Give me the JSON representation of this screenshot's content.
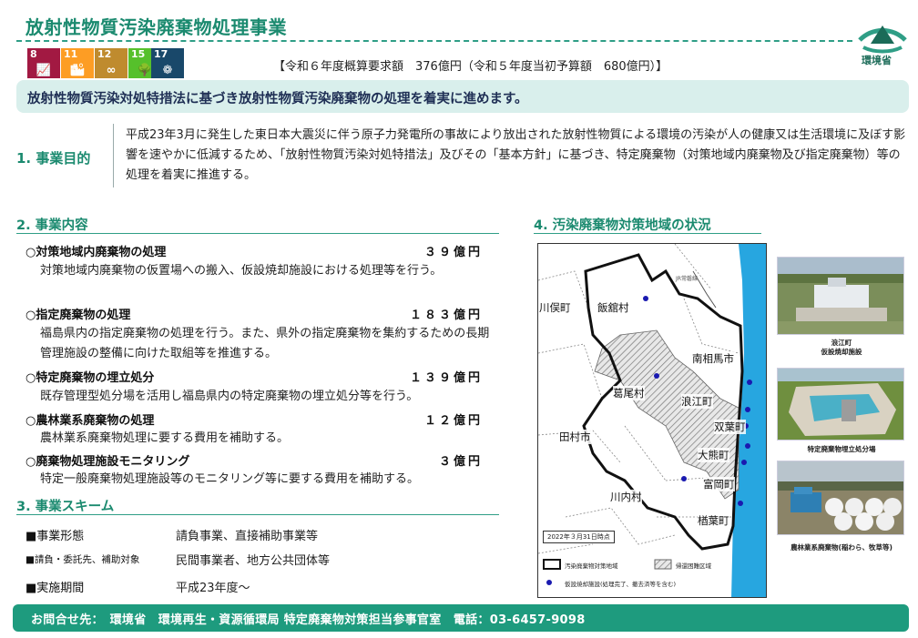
{
  "header": {
    "title": "放射性物質汚染廃棄物処理事業",
    "ministry": "環境省",
    "budget": "【令和６年度概算要求額　376億円（令和５年度当初予算額　680億円）】"
  },
  "sdgs": [
    {
      "number": "8",
      "label": "",
      "color": "#a21942",
      "glyph": "📈"
    },
    {
      "number": "11",
      "label": "",
      "color": "#fd9d24",
      "glyph": "🏙"
    },
    {
      "number": "12",
      "label": "",
      "color": "#bf8b2e",
      "glyph": "∞"
    },
    {
      "number": "15",
      "label": "",
      "color": "#56c02b",
      "glyph": "🌳"
    },
    {
      "number": "17",
      "label": "",
      "color": "#19486a",
      "glyph": "❁"
    }
  ],
  "banner": "放射性物質汚染対処特措法に基づき放射性物質汚染廃棄物の処理を着実に進めます。",
  "purpose": {
    "heading": "1. 事業目的",
    "text": "平成23年3月に発生した東日本大震災に伴う原子力発電所の事故により放出された放射性物質による環境の汚染が人の健康又は生活環境に及ぼす影響を速やかに低減するため、「放射性物質汚染対処特措法」及びその「基本方針」に基づき、特定廃棄物（対策地域内廃棄物及び指定廃棄物）等の処理を着実に推進する。"
  },
  "contents": {
    "heading": "2. 事業内容",
    "items": [
      {
        "title": "○対策地域内廃棄物の処理",
        "amount": "３９億円",
        "desc": "対策地域内廃棄物の仮置場への搬入、仮設焼却施設における処理等を行う。"
      },
      {
        "title": "○指定廃棄物の処理",
        "amount": "１８３億円",
        "desc": "福島県内の指定廃棄物の処理を行う。また、県外の指定廃棄物を集約するための長期管理施設の整備に向けた取組等を推進する。"
      },
      {
        "title": "○特定廃棄物の埋立処分",
        "amount": "１３９億円",
        "desc": "既存管理型処分場を活用し福島県内の特定廃棄物の埋立処分等を行う。"
      },
      {
        "title": "○農林業系廃棄物の処理",
        "amount": "１２億円",
        "desc": "農林業系廃棄物処理に要する費用を補助する。"
      },
      {
        "title": "○廃棄物処理施設モニタリング",
        "amount": "３億円",
        "desc": "特定一般廃棄物処理施設等のモニタリング等に要する費用を補助する。"
      }
    ]
  },
  "scheme": {
    "heading": "3. 事業スキーム",
    "rows": [
      {
        "label": "■事業形態",
        "value": "請負事業、直接補助事業等"
      },
      {
        "label": "■請負・委託先、補助対象",
        "value": "民間事業者、地方公共団体等"
      },
      {
        "label": "■実施期間",
        "value": "平成23年度～"
      }
    ]
  },
  "map": {
    "heading": "4.  汚染廃棄物対策地域の状況",
    "labels": {
      "kawamata": "川俣町",
      "iitate": "飯舘村",
      "minamisoma": "南相馬市",
      "katsurao": "葛尾村",
      "namie": "浪江町",
      "futaba": "双葉町",
      "tamura": "田村市",
      "okuma": "大熊町",
      "tomioka": "富岡町",
      "kawauchi": "川内村",
      "naraha": "楢葉町",
      "jr": "JR常磐線"
    },
    "date": "2022年３月31日時点",
    "legend": {
      "area": "汚染廃棄物対策地域",
      "restricted": "帰還困難区域",
      "facility": "仮設焼却施設(処理完了、撤去済等を含む)"
    },
    "colors": {
      "sea": "#27a6e0",
      "facility": "#1a1ab0",
      "boundary": "#111111"
    }
  },
  "photos": [
    {
      "caption": "浪江町\n仮設焼却施設"
    },
    {
      "caption": "特定廃棄物埋立処分場"
    },
    {
      "caption": "農林業系廃棄物(稲わら、牧草等)"
    }
  ],
  "footer": "お問合せ先：　環境省　環境再生・資源循環局 特定廃棄物対策担当参事官室　電話：03-6457-9098"
}
